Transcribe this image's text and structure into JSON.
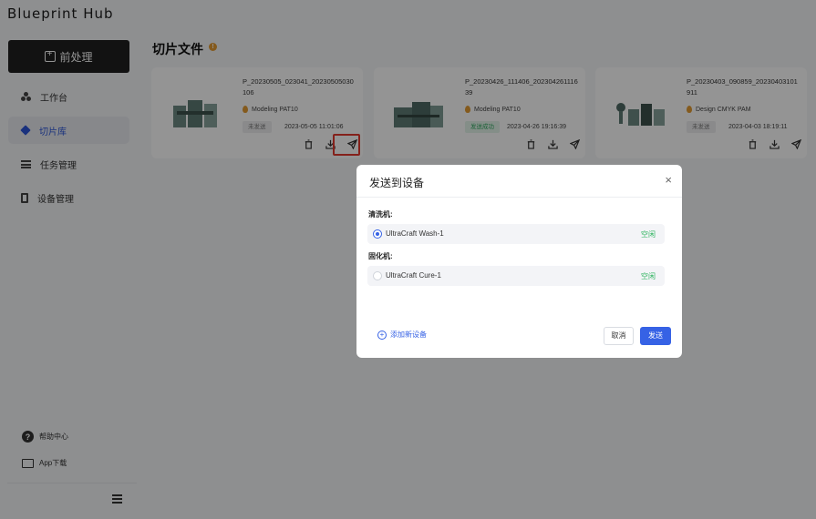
{
  "app": {
    "title": "Blueprint Hub"
  },
  "sidebar": {
    "primary_button": "前处理",
    "items": [
      {
        "label": "工作台",
        "icon": "workbench-icon",
        "active": false
      },
      {
        "label": "切片库",
        "icon": "layers-icon",
        "active": true
      },
      {
        "label": "任务管理",
        "icon": "task-list-icon",
        "active": false
      },
      {
        "label": "设备管理",
        "icon": "device-icon",
        "active": false
      }
    ],
    "footer": [
      {
        "label": "帮助中心",
        "icon": "help-icon"
      },
      {
        "label": "App下载",
        "icon": "app-download-icon"
      }
    ]
  },
  "main": {
    "title": "切片文件",
    "cards": [
      {
        "filename": "P_20230505_023041_20230505030106",
        "material": "Modeling PAT10",
        "status": "未发送",
        "status_type": "unsent",
        "date": "2023-05-05 11:01:06"
      },
      {
        "filename": "P_20230426_111406_20230426111639",
        "material": "Modeling PAT10",
        "status": "发送成功",
        "status_type": "sent",
        "date": "2023-04-26 19:16:39"
      },
      {
        "filename": "P_20230403_090859_20230403101911",
        "material": "Design CMYK PAM",
        "status": "未发送",
        "status_type": "unsent",
        "date": "2023-04-03 18:19:11"
      }
    ]
  },
  "modal": {
    "title": "发送到设备",
    "close": "×",
    "groups": [
      {
        "label": "清洗机:",
        "device": "UltraCraft Wash-1",
        "state": "空闲",
        "selected": true
      },
      {
        "label": "固化机:",
        "device": "UltraCraft Cure-1",
        "state": "空闲",
        "selected": false
      }
    ],
    "add_device": "添加新设备",
    "cancel": "取消",
    "send": "发送"
  },
  "colors": {
    "accent": "#3662e5",
    "idle": "#2fb45f",
    "highlight": "#e33a2f",
    "warning": "#e39b32"
  }
}
